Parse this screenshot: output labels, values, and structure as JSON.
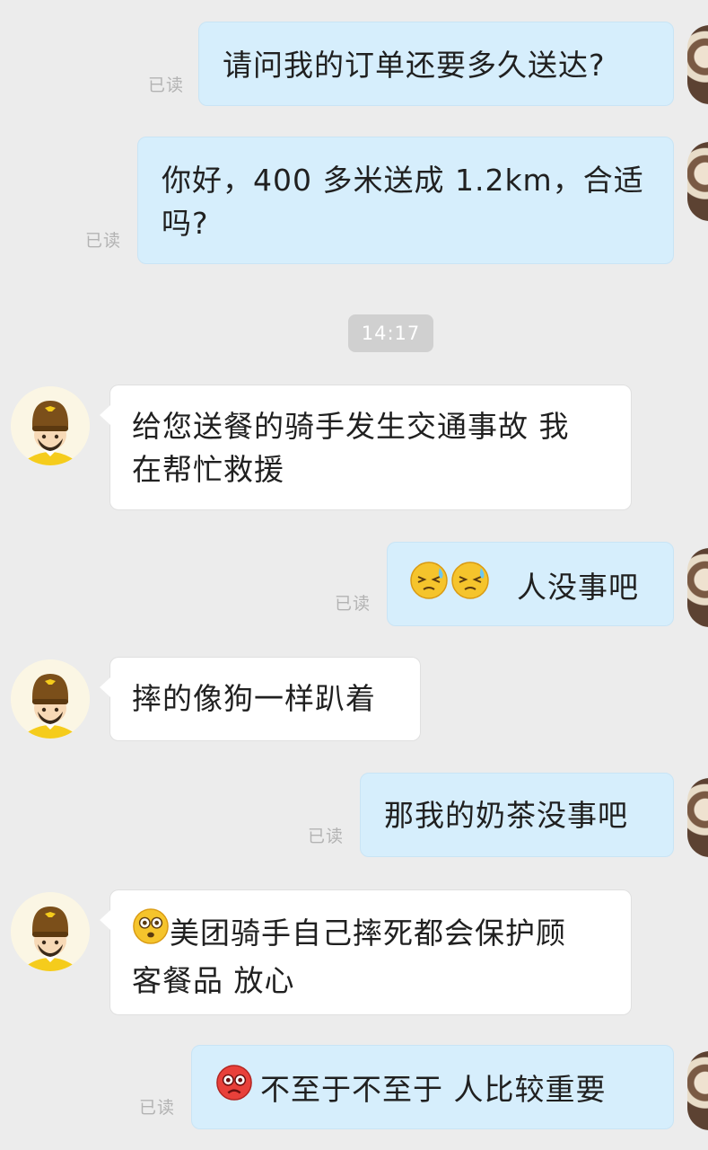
{
  "time_divider": "14:17",
  "messages": [
    {
      "sender": "user",
      "text": "请问我的订单还要多久送达?",
      "status": "已读"
    },
    {
      "sender": "user",
      "line1": "你好，400 多米送成 1.2km，合适",
      "line2": "吗?",
      "status": "已读"
    },
    {
      "sender": "rider",
      "line1": "给您送餐的骑手发生交通事故 我",
      "line2": "在帮忙救援"
    },
    {
      "sender": "user",
      "emoji": [
        "sweat-squint-emoji",
        "sweat-squint-emoji"
      ],
      "text": "人没事吧",
      "status": "已读"
    },
    {
      "sender": "rider",
      "text": "摔的像狗一样趴着"
    },
    {
      "sender": "user",
      "text": "那我的奶茶没事吧",
      "status": "已读"
    },
    {
      "sender": "rider",
      "emoji": [
        "shocked-face-emoji"
      ],
      "line1": "美团骑手自己摔死都会保护顾",
      "line2": "客餐品  放心"
    },
    {
      "sender": "user",
      "emoji": [
        "angry-face-emoji"
      ],
      "text": "不至于不至于  人比较重要",
      "status": "已读"
    }
  ],
  "colors": {
    "background": "#ececec",
    "outgoing_bubble": "#d6eefc",
    "incoming_bubble": "#ffffff",
    "read_receipt": "#b3b3b3",
    "rider_helmet": "#7b4f1a",
    "rider_shirt": "#f5cc1c"
  }
}
